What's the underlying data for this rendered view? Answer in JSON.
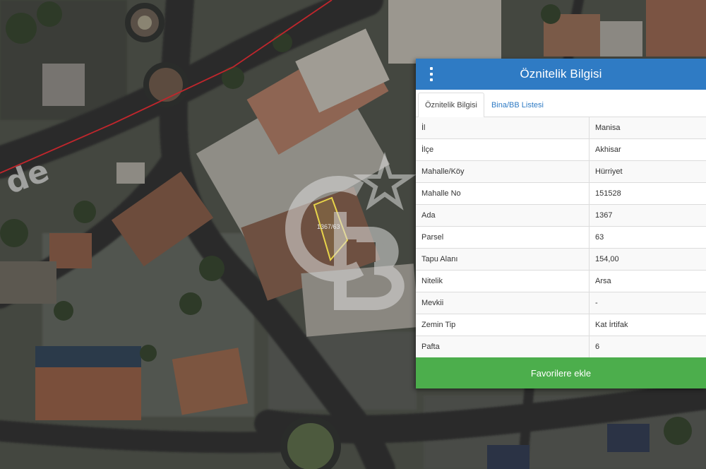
{
  "panel": {
    "title": "Öznitelik Bilgisi",
    "menu_icon": "vertical-dots-icon",
    "tabs": [
      {
        "label": "Öznitelik Bilgisi",
        "active": true
      },
      {
        "label": "Bina/BB Listesi",
        "active": false
      }
    ],
    "rows": [
      {
        "key": "İl",
        "value": "Manisa"
      },
      {
        "key": "İlçe",
        "value": "Akhisar"
      },
      {
        "key": "Mahalle/Köy",
        "value": "Hürriyet"
      },
      {
        "key": "Mahalle No",
        "value": "151528"
      },
      {
        "key": "Ada",
        "value": "1367"
      },
      {
        "key": "Parsel",
        "value": "63"
      },
      {
        "key": "Tapu Alanı",
        "value": "154,00"
      },
      {
        "key": "Nitelik",
        "value": "Arsa"
      },
      {
        "key": "Mevkii",
        "value": "-"
      },
      {
        "key": "Zemin Tip",
        "value": "Kat İrtifak"
      },
      {
        "key": "Pafta",
        "value": "6"
      }
    ],
    "favorite_button": "Favorilere ekle"
  },
  "map": {
    "parcel_label": "1367/63",
    "watermark": "GB",
    "street_label_fragment": "de",
    "colors": {
      "header": "#2f7bc4",
      "button": "#4cae4c",
      "parcel_outline": "#e8d54a",
      "boundary_line": "#c0262c"
    }
  }
}
